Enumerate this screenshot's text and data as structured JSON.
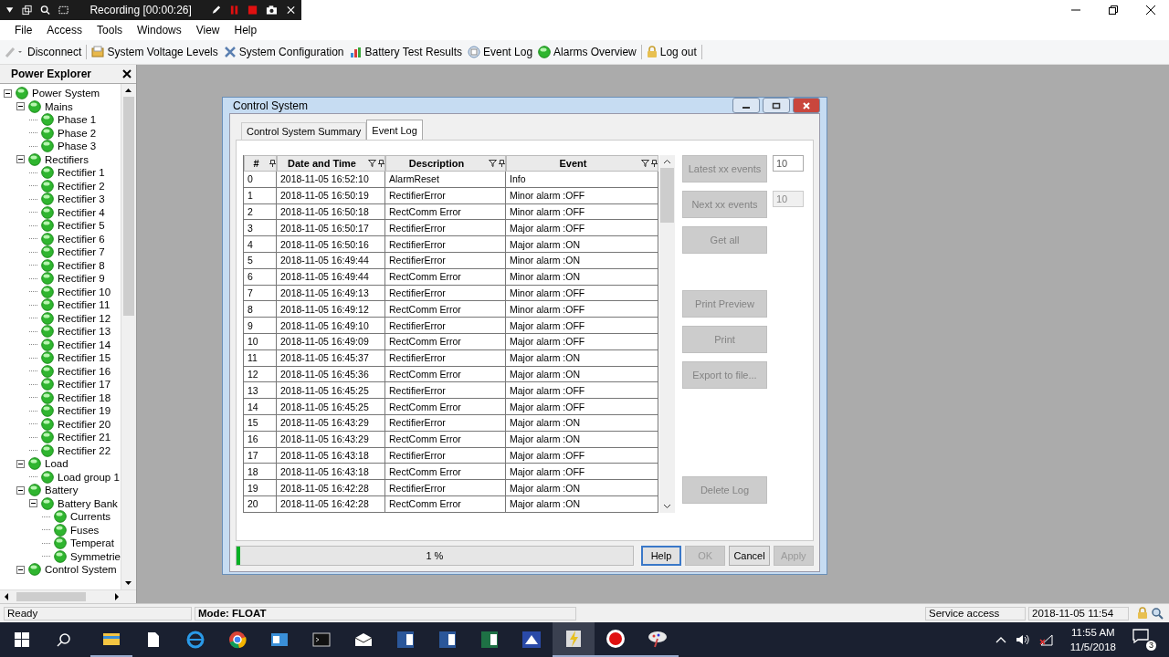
{
  "recorder": {
    "status": "Recording [00:00:26]"
  },
  "menu": [
    "File",
    "Access",
    "Tools",
    "Windows",
    "View",
    "Help"
  ],
  "toolbar": [
    {
      "kind": "disconnect",
      "label": "Disconnect"
    },
    {
      "kind": "voltage",
      "label": "System Voltage Levels"
    },
    {
      "kind": "config",
      "label": "System Configuration"
    },
    {
      "kind": "chart",
      "label": "Battery Test Results"
    },
    {
      "kind": "log",
      "label": "Event Log"
    },
    {
      "kind": "alarm",
      "label": "Alarms Overview"
    },
    {
      "kind": "lock",
      "label": "Log out"
    }
  ],
  "explorer": {
    "title": "Power Explorer",
    "tree": [
      {
        "label": "Power System",
        "expanded": true,
        "children": [
          {
            "label": "Mains",
            "expanded": true,
            "children": [
              {
                "label": "Phase 1"
              },
              {
                "label": "Phase 2"
              },
              {
                "label": "Phase 3"
              }
            ]
          },
          {
            "label": "Rectifiers",
            "expanded": true,
            "children": [
              {
                "label": "Rectifier 1"
              },
              {
                "label": "Rectifier 2"
              },
              {
                "label": "Rectifier 3"
              },
              {
                "label": "Rectifier 4"
              },
              {
                "label": "Rectifier 5"
              },
              {
                "label": "Rectifier 6"
              },
              {
                "label": "Rectifier 7"
              },
              {
                "label": "Rectifier 8"
              },
              {
                "label": "Rectifier 9"
              },
              {
                "label": "Rectifier 10"
              },
              {
                "label": "Rectifier 11"
              },
              {
                "label": "Rectifier 12"
              },
              {
                "label": "Rectifier 13"
              },
              {
                "label": "Rectifier 14"
              },
              {
                "label": "Rectifier 15"
              },
              {
                "label": "Rectifier 16"
              },
              {
                "label": "Rectifier 17"
              },
              {
                "label": "Rectifier 18"
              },
              {
                "label": "Rectifier 19"
              },
              {
                "label": "Rectifier 20"
              },
              {
                "label": "Rectifier 21"
              },
              {
                "label": "Rectifier 22"
              }
            ]
          },
          {
            "label": "Load",
            "expanded": true,
            "children": [
              {
                "label": "Load group 1"
              }
            ]
          },
          {
            "label": "Battery",
            "expanded": true,
            "children": [
              {
                "label": "Battery Bank",
                "expanded": true,
                "children": [
                  {
                    "label": "Currents"
                  },
                  {
                    "label": "Fuses"
                  },
                  {
                    "label": "Temperat"
                  },
                  {
                    "label": "Symmetrie"
                  }
                ]
              }
            ]
          },
          {
            "label": "Control System",
            "expanded": true
          }
        ]
      }
    ]
  },
  "dialog": {
    "title": "Control System",
    "tabs": [
      {
        "label": "Control System Summary",
        "selected": false
      },
      {
        "label": "Event Log",
        "selected": true
      }
    ],
    "columns": [
      {
        "label": "#",
        "filter": false
      },
      {
        "label": "Date and Time",
        "filter": true
      },
      {
        "label": "Description",
        "filter": true
      },
      {
        "label": "Event",
        "filter": true
      }
    ],
    "rows": [
      [
        "0",
        "2018-11-05 16:52:10",
        "AlarmReset",
        "Info"
      ],
      [
        "1",
        "2018-11-05 16:50:19",
        "RectifierError",
        "Minor alarm :OFF"
      ],
      [
        "2",
        "2018-11-05 16:50:18",
        "RectComm Error",
        "Minor alarm :OFF"
      ],
      [
        "3",
        "2018-11-05 16:50:17",
        "RectifierError",
        "Major alarm :OFF"
      ],
      [
        "4",
        "2018-11-05 16:50:16",
        "RectifierError",
        "Major alarm :ON"
      ],
      [
        "5",
        "2018-11-05 16:49:44",
        "RectifierError",
        "Minor alarm :ON"
      ],
      [
        "6",
        "2018-11-05 16:49:44",
        "RectComm Error",
        "Minor alarm :ON"
      ],
      [
        "7",
        "2018-11-05 16:49:13",
        "RectifierError",
        "Minor alarm :OFF"
      ],
      [
        "8",
        "2018-11-05 16:49:12",
        "RectComm Error",
        "Minor alarm :OFF"
      ],
      [
        "9",
        "2018-11-05 16:49:10",
        "RectifierError",
        "Major alarm :OFF"
      ],
      [
        "10",
        "2018-11-05 16:49:09",
        "RectComm Error",
        "Major alarm :OFF"
      ],
      [
        "11",
        "2018-11-05 16:45:37",
        "RectifierError",
        "Major alarm :ON"
      ],
      [
        "12",
        "2018-11-05 16:45:36",
        "RectComm Error",
        "Major alarm :ON"
      ],
      [
        "13",
        "2018-11-05 16:45:25",
        "RectifierError",
        "Major alarm :OFF"
      ],
      [
        "14",
        "2018-11-05 16:45:25",
        "RectComm Error",
        "Major alarm :OFF"
      ],
      [
        "15",
        "2018-11-05 16:43:29",
        "RectifierError",
        "Major alarm :ON"
      ],
      [
        "16",
        "2018-11-05 16:43:29",
        "RectComm Error",
        "Major alarm :ON"
      ],
      [
        "17",
        "2018-11-05 16:43:18",
        "RectifierError",
        "Major alarm :OFF"
      ],
      [
        "18",
        "2018-11-05 16:43:18",
        "RectComm Error",
        "Major alarm :OFF"
      ],
      [
        "19",
        "2018-11-05 16:42:28",
        "RectifierError",
        "Major alarm :ON"
      ],
      [
        "20",
        "2018-11-05 16:42:28",
        "RectComm Error",
        "Major alarm :ON"
      ]
    ],
    "side_groups": [
      [
        {
          "label": "Latest xx events",
          "disabled": true,
          "count": {
            "value": "10",
            "disabled": false
          }
        },
        {
          "label": "Next xx events",
          "disabled": true,
          "count": {
            "value": "10",
            "disabled": true
          }
        },
        {
          "label": "Get all",
          "disabled": true
        }
      ],
      [
        {
          "label": "Print Preview",
          "disabled": true
        },
        {
          "label": "Print",
          "disabled": true
        },
        {
          "label": "Export to file...",
          "disabled": true
        }
      ],
      [
        {
          "label": "Delete Log",
          "disabled": true
        }
      ]
    ],
    "progress": {
      "text": "1 %",
      "level": 0.01
    },
    "buttons": [
      {
        "label": "Help",
        "disabled": false,
        "focused": true
      },
      {
        "label": "OK",
        "disabled": true,
        "focused": false
      },
      {
        "label": "Cancel",
        "disabled": false,
        "focused": false
      },
      {
        "label": "Apply",
        "disabled": true,
        "focused": false
      }
    ]
  },
  "status_bar": {
    "state": "Ready",
    "mode": "Mode: FLOAT",
    "access": "Service access",
    "datetime": "2018-11-05 11:54"
  },
  "taskbar": {
    "apps": [
      {
        "kind": "folder",
        "running": true,
        "selected": false
      },
      {
        "kind": "file",
        "running": false,
        "selected": false
      },
      {
        "kind": "browser",
        "running": false,
        "selected": false
      },
      {
        "kind": "chrome",
        "running": false,
        "selected": false
      },
      {
        "kind": "panel",
        "running": false,
        "selected": false
      },
      {
        "kind": "terminal",
        "running": false,
        "selected": false
      },
      {
        "kind": "mail",
        "running": false,
        "selected": false
      },
      {
        "kind": "word",
        "running": false,
        "selected": false
      },
      {
        "kind": "outlook",
        "running": false,
        "selected": false
      },
      {
        "kind": "excel",
        "running": false,
        "selected": false
      },
      {
        "kind": "scanner",
        "running": false,
        "selected": false
      },
      {
        "kind": "power",
        "running": true,
        "selected": true
      },
      {
        "kind": "record",
        "running": true,
        "selected": false
      },
      {
        "kind": "paint",
        "running": true,
        "selected": false
      }
    ],
    "time": "11:55 AM",
    "date": "11/5/2018",
    "notifications": "3"
  }
}
